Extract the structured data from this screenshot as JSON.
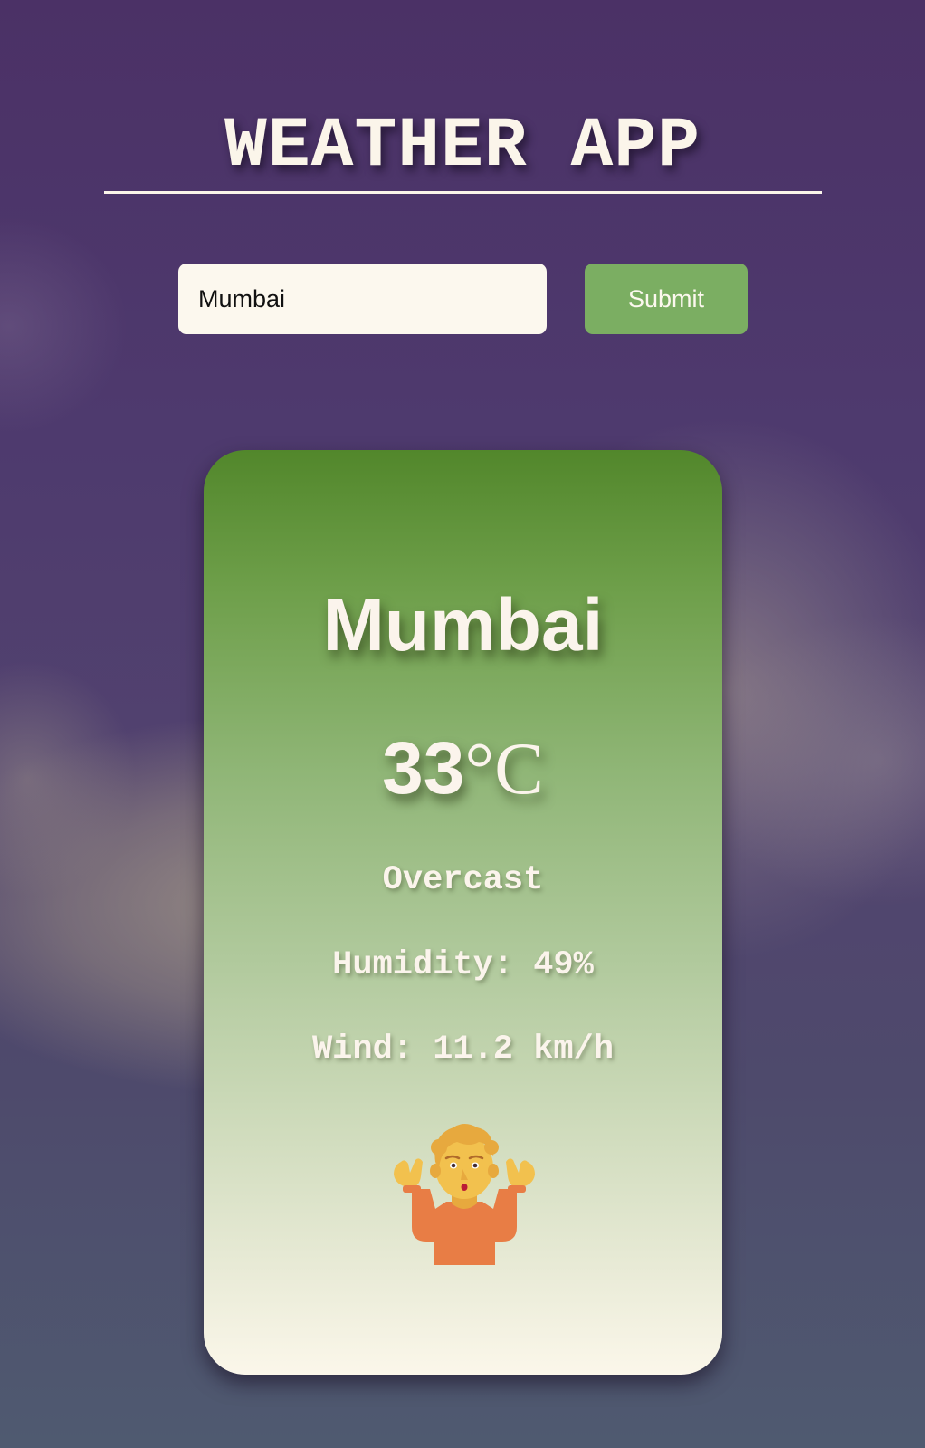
{
  "app": {
    "title": "WEATHER APP"
  },
  "search": {
    "value": "Mumbai",
    "submit_label": "Submit"
  },
  "weather": {
    "city": "Mumbai",
    "temperature": "33",
    "temperature_unit": "°C",
    "condition": "Overcast",
    "humidity": "Humidity: 49%",
    "wind": "Wind: 11.2 km/h",
    "icon": "person-shrugging-icon"
  }
}
